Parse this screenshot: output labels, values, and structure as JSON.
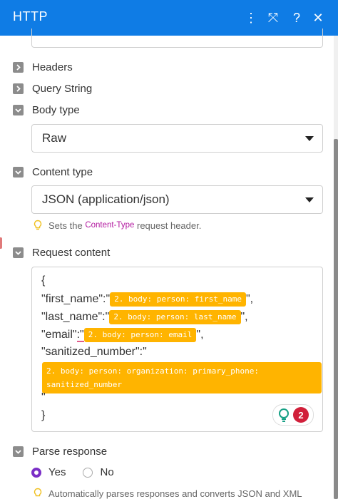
{
  "header": {
    "title": "HTTP",
    "icons": [
      "more-vertical-icon",
      "expand-icon",
      "help-icon",
      "close-icon"
    ],
    "icon_glyphs": {
      "more": "⋮",
      "expand": "⤧",
      "help": "?",
      "close": "✕"
    },
    "background": "#0f7ce5"
  },
  "sections": {
    "headers": "Headers",
    "query_string": "Query String",
    "body_type": "Body type",
    "content_type": "Content type",
    "request_content": "Request content",
    "parse_response": "Parse response"
  },
  "body_type_select": {
    "value": "Raw"
  },
  "content_type_select": {
    "value": "JSON (application/json)"
  },
  "content_type_hint": {
    "prefix": "Sets the",
    "tag": "Content-Type",
    "suffix": "request header."
  },
  "request_content": {
    "open_brace": "{",
    "line1_key": "\"first_name\":\"",
    "line1_pill": "2. body: person: first_name",
    "line1_end": "\",",
    "line2_key": "\"last_name\":\"",
    "line2_pill": "2. body: person: last_name",
    "line2_end": "\",",
    "line3_key_a": "\"email\"",
    "line3_key_b": ":\"",
    "line3_pill": "2. body: person: email",
    "line3_end": "\",",
    "line4_key": "\"sanitized_number\":\"",
    "line4_pill": "2. body: person: organization: primary_phone: sanitized_number",
    "line5": "\"",
    "close_brace": "}",
    "badge_count": "2"
  },
  "parse_response": {
    "options": [
      "Yes",
      "No"
    ],
    "selected": "Yes",
    "hint": "Automatically parses responses and converts JSON and XML"
  },
  "colors": {
    "pill": "#ffb400",
    "radio_selected": "#7b2fc7",
    "badge": "#d11f3a"
  }
}
